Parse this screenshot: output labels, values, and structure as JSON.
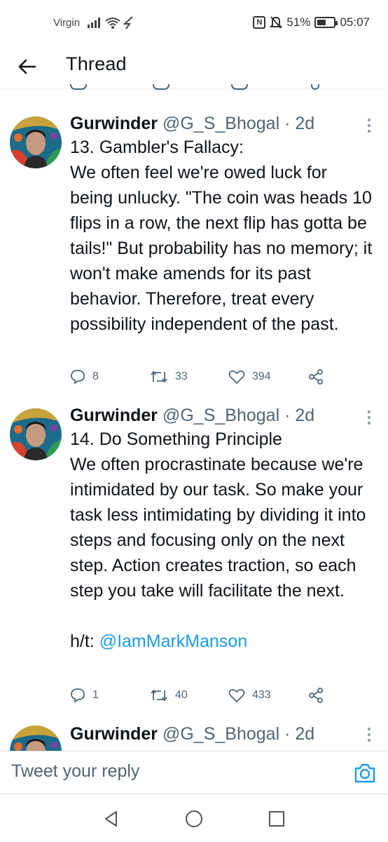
{
  "status_bar": {
    "carrier": "Virgin",
    "nfc": "N",
    "battery_percent": "51%",
    "battery_level": 0.51,
    "time": "05:07"
  },
  "header": {
    "title": "Thread"
  },
  "tweets": [
    {
      "name": "Gurwinder",
      "handle": "@G_S_Bhogal",
      "time": "· 2d",
      "text": "13. Gambler's Fallacy:\nWe often feel we're owed luck for being unlucky. \"The coin was heads 10 flips in a row, the next flip has gotta be tails!\" But probability has no memory; it won't make amends for its past behavior. Therefore, treat every possibility independent of the past.",
      "replies": "8",
      "retweets": "33",
      "likes": "394"
    },
    {
      "name": "Gurwinder",
      "handle": "@G_S_Bhogal",
      "time": "· 2d",
      "text": "14. Do Something Principle\nWe often procrastinate because we're intimidated by our task. So make your task less intimidating by dividing it into steps and focusing only on the next step. Action creates traction, so each step you take will facilitate the next.\n\nh/t: ",
      "mention": "@IamMarkManson",
      "replies": "1",
      "retweets": "40",
      "likes": "433"
    },
    {
      "name": "Gurwinder",
      "handle": "@G_S_Bhogal",
      "time": "· 2d"
    }
  ],
  "reply_bar": {
    "placeholder": "Tweet your reply"
  },
  "colors": {
    "accent": "#1d9bf0",
    "secondary_text": "#536471",
    "primary_text": "#0f1419"
  }
}
